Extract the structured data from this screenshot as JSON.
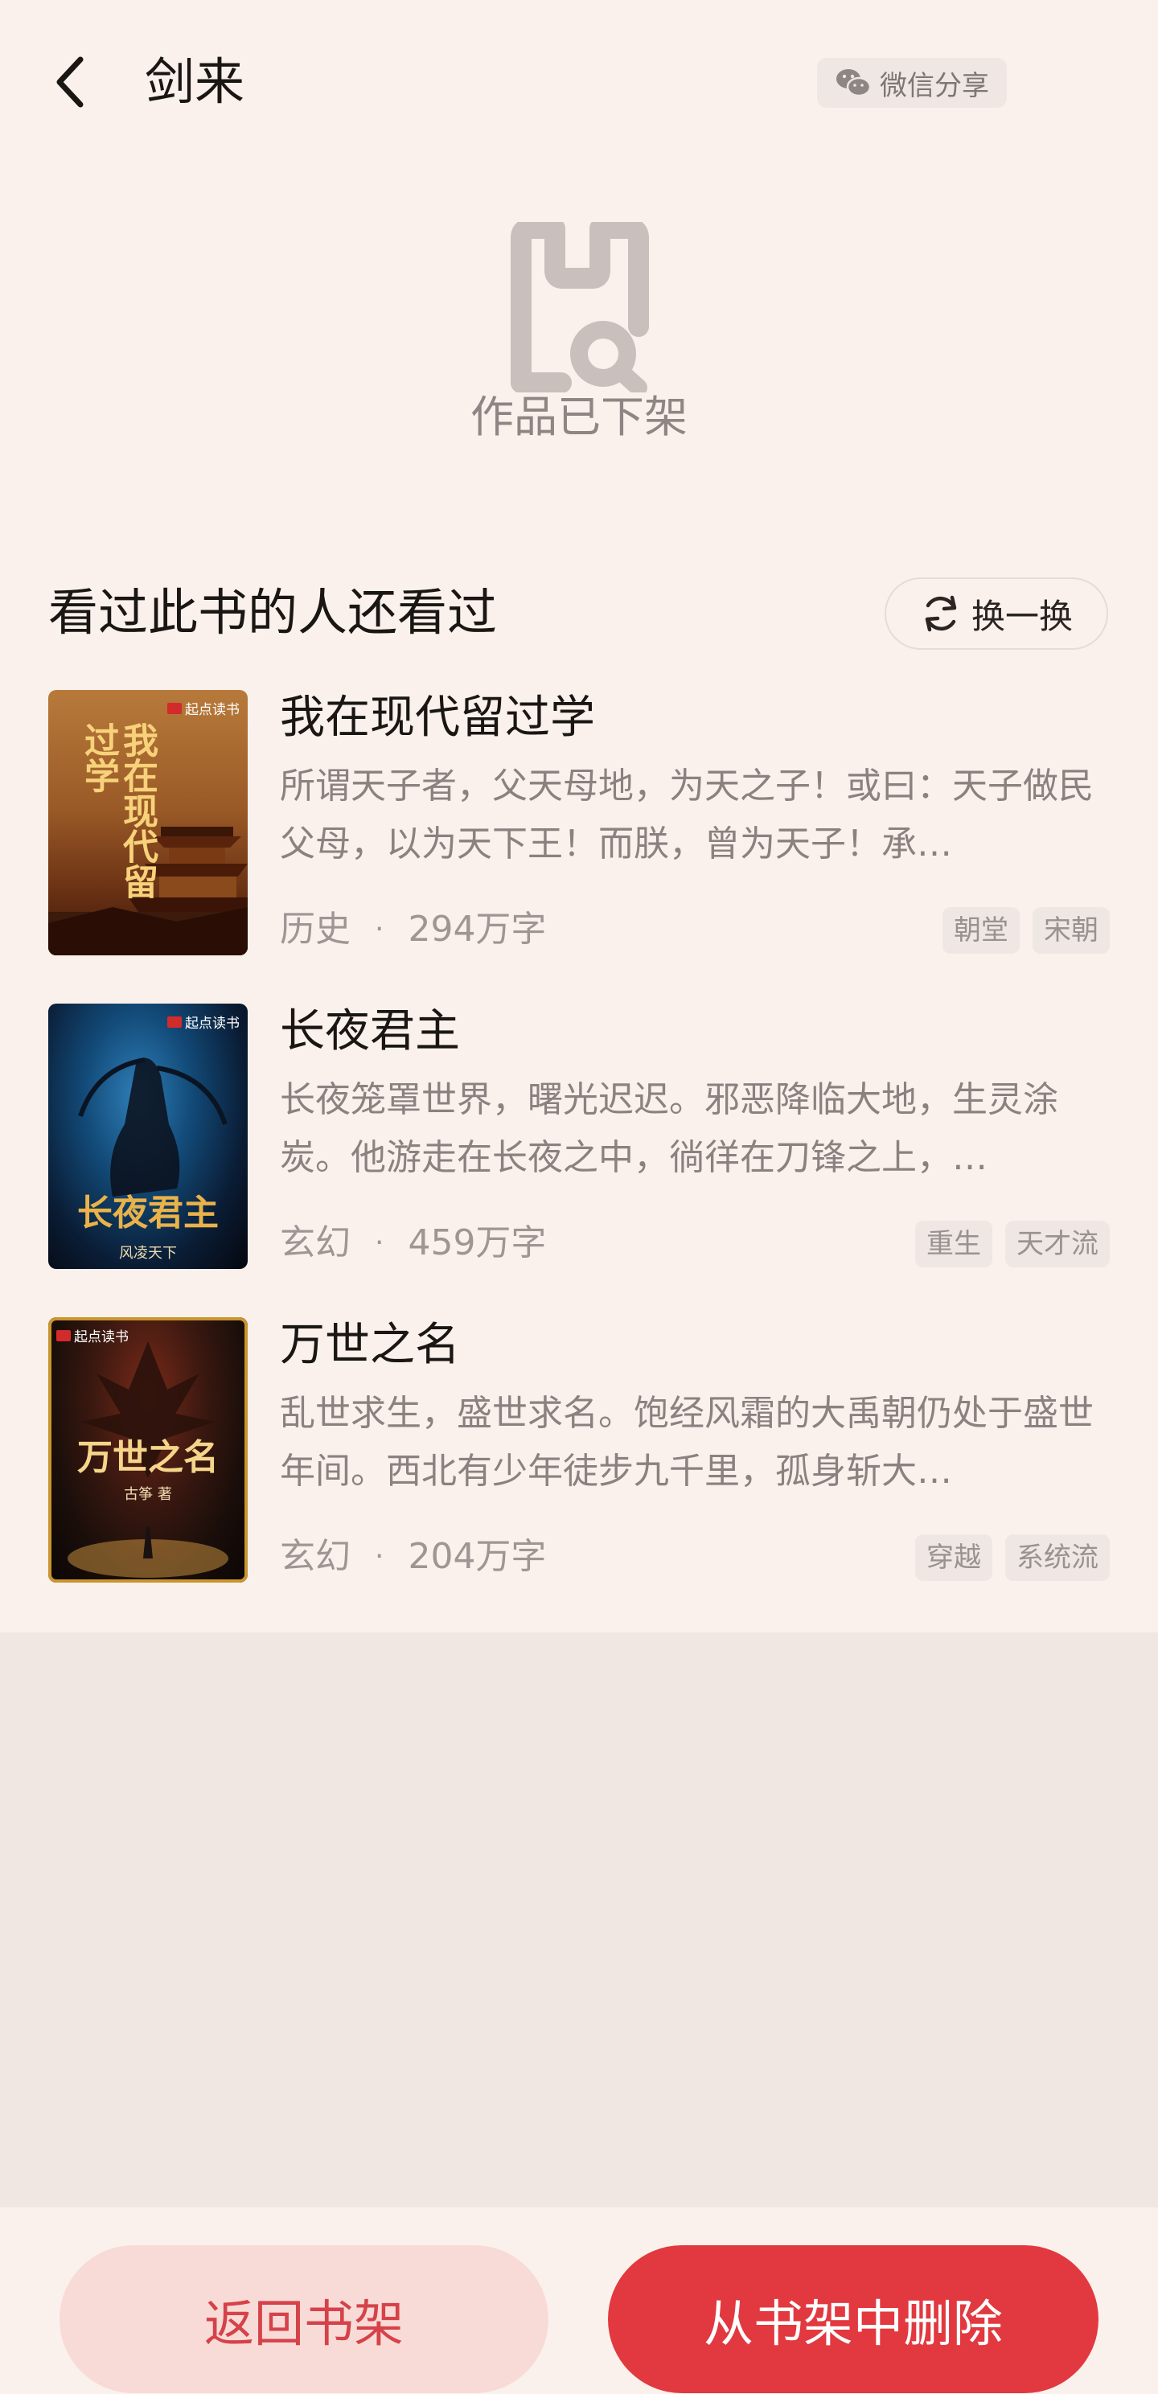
{
  "header": {
    "title": "剑来",
    "share_label": "微信分享"
  },
  "status": {
    "message": "作品已下架"
  },
  "recommend": {
    "title": "看过此书的人还看过",
    "refresh_label": "换一换",
    "books": [
      {
        "cover_title": "我在现代留过学",
        "cover_publisher": "起点读书",
        "name": "我在现代留过学",
        "description": "所谓天子者，父天母地，为天之子！或曰：天子做民父母，以为天下王！而朕，曾为天子！承…",
        "category": "历史",
        "words": "294万字",
        "tags": [
          "朝堂",
          "宋朝"
        ]
      },
      {
        "cover_title": "长夜君主",
        "cover_publisher": "起点读书",
        "cover_author": "风凌天下",
        "name": "长夜君主",
        "description": "长夜笼罩世界，曙光迟迟。邪恶降临大地，生灵涂炭。他游走在长夜之中，徜徉在刀锋之上，…",
        "category": "玄幻",
        "words": "459万字",
        "tags": [
          "重生",
          "天才流"
        ]
      },
      {
        "cover_title": "万世之名",
        "cover_publisher": "起点读书",
        "cover_author": "古筝 著",
        "name": "万世之名",
        "description": "乱世求生，盛世求名。饱经风霜的大禹朝仍处于盛世年间。西北有少年徒步九千里，孤身斩大…",
        "category": "玄幻",
        "words": "204万字",
        "tags": [
          "穿越",
          "系统流"
        ]
      }
    ]
  },
  "footer": {
    "back_label": "返回书架",
    "delete_label": "从书架中删除"
  },
  "colors": {
    "accent": "#E2383F",
    "accent_light": "#F8DBD6",
    "page_bg": "#FAF1EC"
  }
}
